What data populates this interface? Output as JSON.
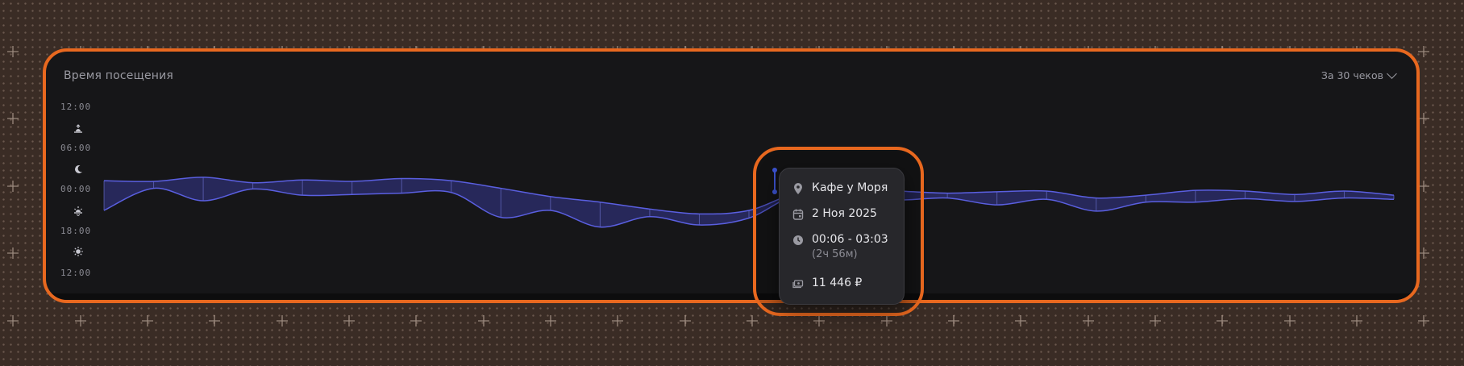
{
  "card": {
    "title": "Время посещения",
    "period_label": "За 30 чеков"
  },
  "axis": {
    "ticks": [
      "12:00",
      "06:00",
      "00:00",
      "18:00",
      "12:00"
    ],
    "icons": [
      "sunrise-icon",
      "moon-icon",
      "sunset-icon",
      "sun-icon"
    ]
  },
  "tooltip": {
    "place": "Кафе у Моря",
    "date": "2 Ноя 2025",
    "time_range": "00:06 - 03:03",
    "duration": "(2ч 56м)",
    "amount": "11 446 ₽"
  },
  "colors": {
    "accent": "#e8681f",
    "band_fill": "#3b3fa0",
    "band_stroke": "#5a5fe0",
    "card_bg": "#161618"
  },
  "chart_data": {
    "type": "area",
    "title": "Время посещения",
    "y_axis": "time of day (hours), top = 12:00, bottom = 12:00 next day",
    "ylim": [
      12,
      36
    ],
    "series": [
      {
        "values_start": [
          22.5,
          22.6,
          22.0,
          22.8,
          22.4,
          22.6,
          22.2,
          22.5,
          23.6,
          24.8,
          25.6,
          26.6,
          27.3,
          26.8,
          24.2,
          23.8,
          24.0,
          24.3,
          24.1,
          24.0,
          25.0,
          24.6,
          23.9,
          24.0,
          24.5,
          24.0,
          24.6
        ],
        "values_end": [
          26.8,
          23.6,
          25.4,
          23.7,
          24.6,
          24.5,
          24.3,
          24.2,
          27.8,
          26.8,
          29.2,
          27.7,
          28.9,
          27.9,
          24.4,
          24.7,
          25.3,
          25.0,
          26.0,
          25.2,
          26.9,
          25.6,
          25.6,
          25.1,
          25.5,
          25.0,
          25.2
        ]
      }
    ],
    "highlight_index": 14,
    "grid": false
  }
}
